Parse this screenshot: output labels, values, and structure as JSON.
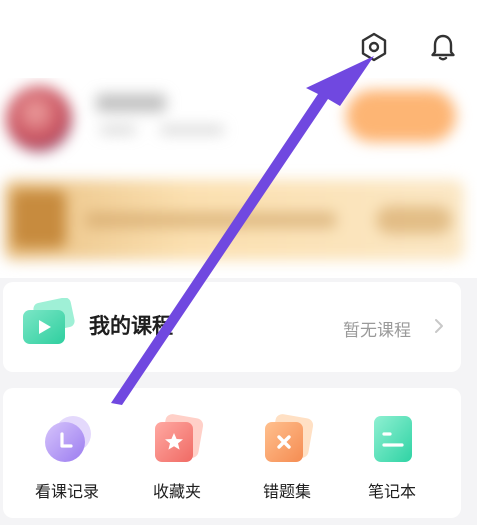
{
  "header": {
    "settings_icon": "settings-hexagon-icon",
    "bell_icon": "bell-icon"
  },
  "profile": {
    "avatar": "avatar",
    "blurred": true
  },
  "my_courses": {
    "title": "我的课程",
    "status": "暂无课程",
    "icon": "course-play-icon"
  },
  "tools": [
    {
      "label": "看课记录",
      "icon": "clock-icon",
      "color": "#b89cf3"
    },
    {
      "label": "收藏夹",
      "icon": "star-icon",
      "color": "#f57f7a"
    },
    {
      "label": "错题集",
      "icon": "cross-icon",
      "color": "#f6a06a"
    },
    {
      "label": "笔记本",
      "icon": "note-icon",
      "color": "#4dd9b0"
    }
  ],
  "annotation": {
    "color": "#7048e0",
    "points_to": "settings-hexagon-icon"
  }
}
